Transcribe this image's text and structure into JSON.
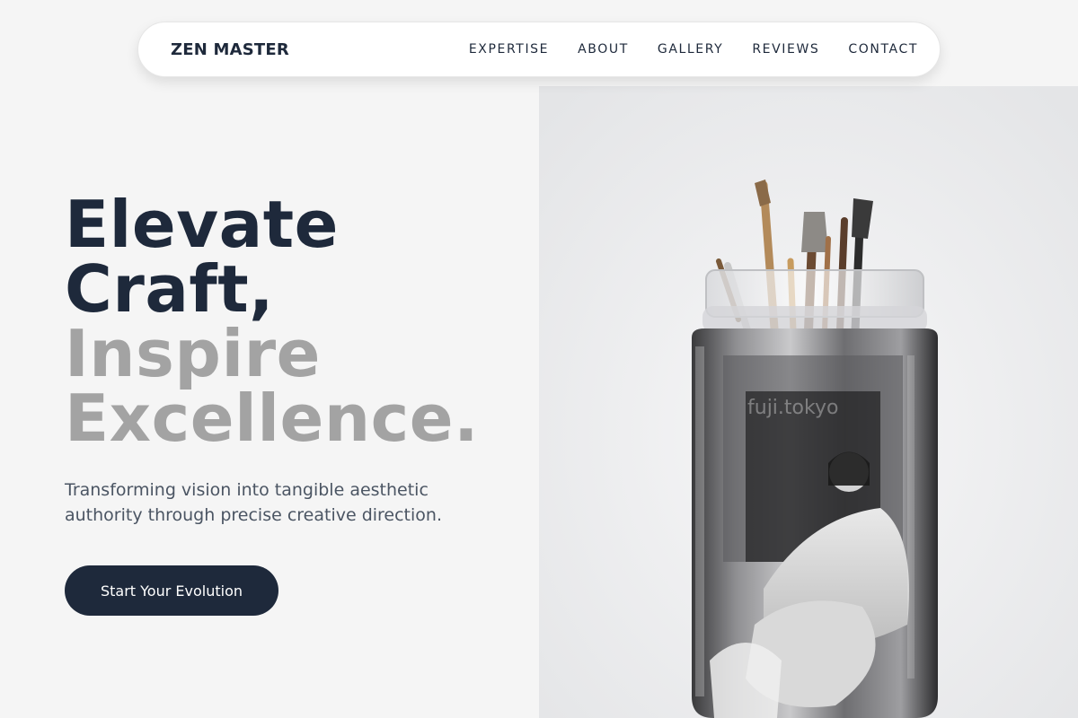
{
  "nav": {
    "brand": "ZEN MASTER",
    "links": [
      "EXPERTISE",
      "ABOUT",
      "GALLERY",
      "REVIEWS",
      "CONTACT"
    ]
  },
  "hero": {
    "headline_dark": [
      "Elevate",
      "Craft,"
    ],
    "headline_light": [
      "Inspire",
      "Excellence."
    ],
    "tagline": "Transforming vision into tangible aesthetic authority through precise creative direction.",
    "cta_label": "Start Your Evolution"
  },
  "image": {
    "description_icon": "jar-with-paintbrushes-photo",
    "watermark": "fuji.tokyo"
  },
  "colors": {
    "primary": "#1e293b",
    "muted": "#a3a3a3",
    "body_text": "#4b5563",
    "page_bg": "#f5f5f5",
    "nav_bg": "#ffffff"
  }
}
